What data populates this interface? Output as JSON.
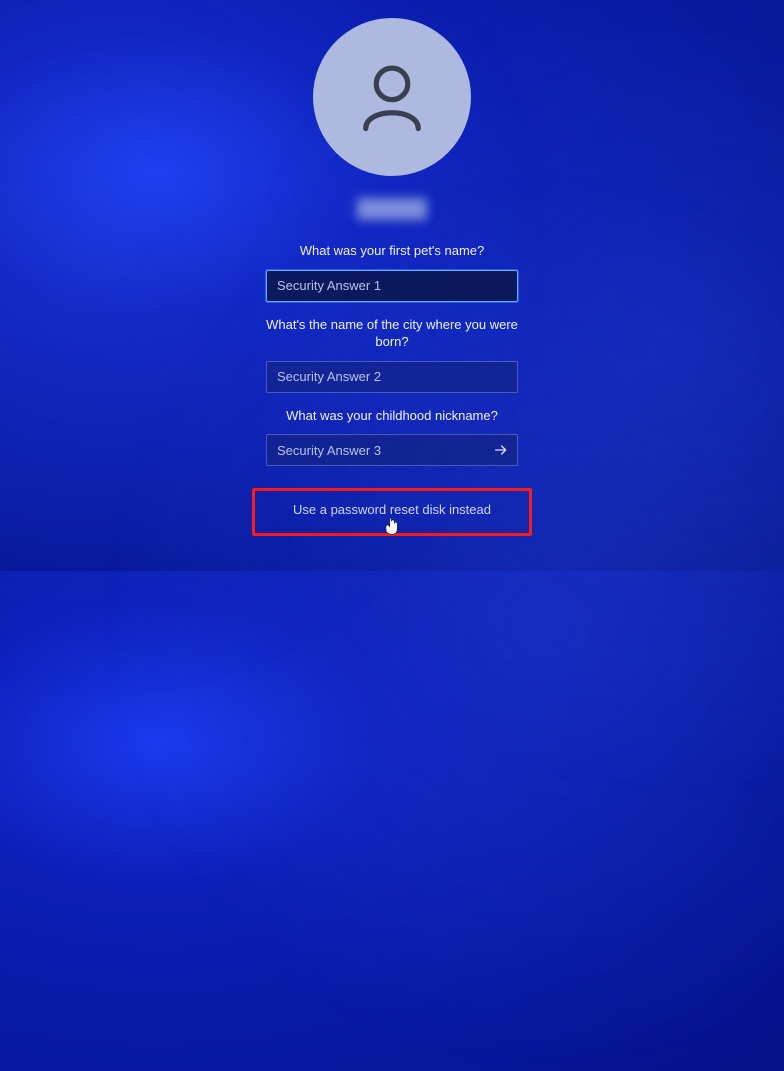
{
  "questions": {
    "q1": {
      "label": "What was your first pet's name?",
      "placeholder": "Security Answer 1",
      "value": ""
    },
    "q2": {
      "label": "What's the name of the city where you were born?",
      "placeholder": "Security Answer 2",
      "value": ""
    },
    "q3": {
      "label": "What was your childhood nickname?",
      "placeholder": "Security Answer 3",
      "value": ""
    }
  },
  "reset_link": {
    "label": "Use a password reset disk instead"
  },
  "colors": {
    "accent": "#1a3aee",
    "highlight": "#ff1a1a"
  }
}
